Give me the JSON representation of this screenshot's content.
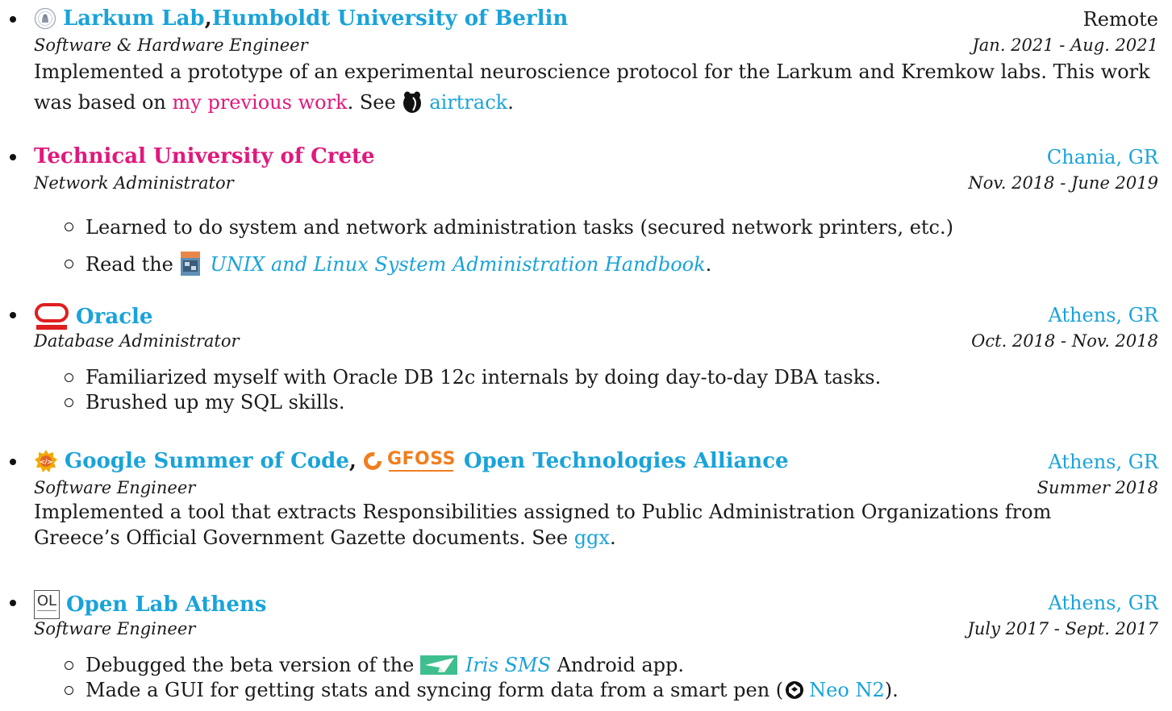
{
  "entries": [
    {
      "title_parts": [
        "Larkum Lab",
        ", ",
        "Humboldt University of Berlin"
      ],
      "location": "Remote",
      "role": "Software & Hardware Engineer",
      "dates": "Jan. 2021 - Aug. 2021",
      "description": {
        "text1": "Implemented a prototype of an experimental neuroscience protocol for the Larkum and Kremkow labs. This work was based on ",
        "link1": "my previous work",
        "text2": ". See ",
        "link2": "airtrack",
        "text3": "."
      }
    },
    {
      "title": "Technical University of Crete",
      "location": "Chania, GR",
      "role": "Network Administrator",
      "dates": "Nov. 2018 - June 2019",
      "bullets": [
        "Learned to do system and network administration tasks (secured network printers, etc.)"
      ],
      "bullet2": {
        "prefix": "Read the ",
        "link": "UNIX and Linux System Administration Handbook",
        "suffix": "."
      }
    },
    {
      "title": "Oracle",
      "location": "Athens, GR",
      "role": "Database Administrator",
      "dates": "Oct. 2018 - Nov. 2018",
      "bullets": [
        "Familiarized myself with Oracle DB 12c internals by doing day-to-day DBA tasks.",
        "Brushed up my SQL skills."
      ]
    },
    {
      "title_parts": [
        "Google Summer of Code",
        ", ",
        "Open Technologies Alliance"
      ],
      "logo_text": "GFOSS",
      "location": "Athens, GR",
      "role": "Software Engineer",
      "dates": "Summer 2018",
      "description": {
        "text1": "Implemented a tool that extracts Responsibilities assigned to Public Administration Organizations from Greece’s Official Government Gazette documents. See ",
        "link1": "ggx",
        "text2": "."
      }
    },
    {
      "title": "Open Lab Athens",
      "logo_text": "OL",
      "location": "Athens, GR",
      "role": "Software Engineer",
      "dates": "July 2017 - Sept. 2017",
      "bullet1": {
        "prefix": "Debugged the beta version of the ",
        "link": "Iris SMS",
        "suffix": " Android app."
      },
      "bullet2": {
        "prefix": "Made a GUI for getting stats and syncing form data from a smart pen (",
        "link": "Neo N2",
        "suffix": ")."
      }
    }
  ],
  "colors": {
    "link_blue": "#1aa3d9",
    "accent_pink": "#e0197d",
    "text": "#1a1a1a"
  },
  "icons": [
    "humboldt-seal-icon",
    "mouse-icon",
    "book-cover-icon",
    "oracle-logo-icon",
    "gsoc-logo-icon",
    "gfoss-logo-icon",
    "open-lab-logo-icon",
    "iris-plane-icon",
    "neo-pen-icon"
  ]
}
